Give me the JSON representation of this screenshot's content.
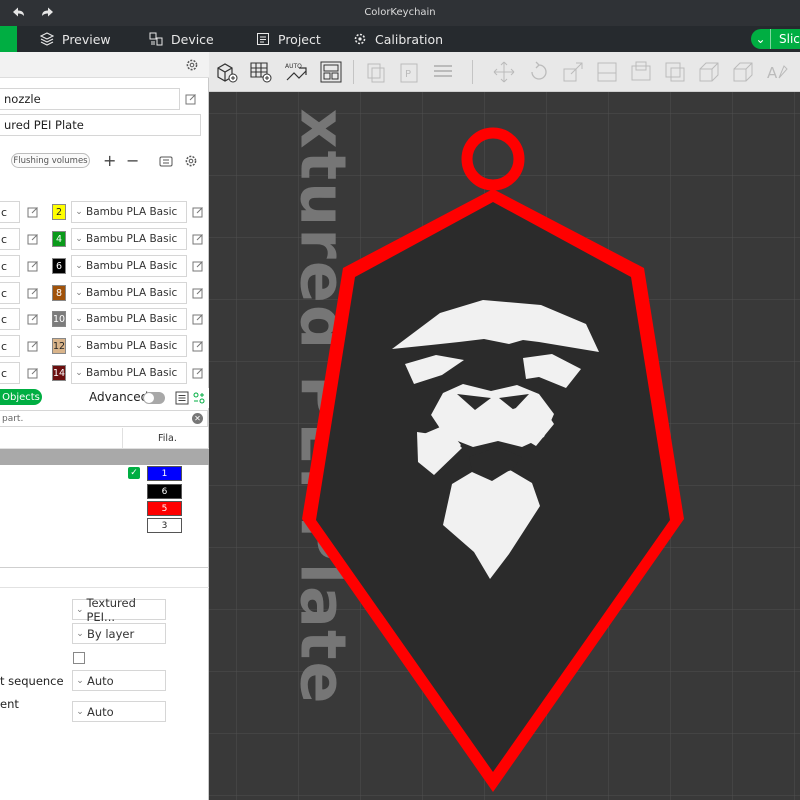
{
  "window": {
    "title": "ColorKeychain"
  },
  "tabs": {
    "preview": "Preview",
    "device": "Device",
    "project": "Project",
    "calibration": "Calibration",
    "slice": "Slic"
  },
  "printer": {
    "nozzle": "nozzle",
    "plate": "ured PEI Plate"
  },
  "filament": {
    "flushing_label": "Flushing volumes",
    "plus": "+",
    "minus": "−",
    "left_cells": [
      "c",
      "c",
      "c",
      "c",
      "c",
      "c",
      "c"
    ],
    "slots": [
      {
        "num": "2",
        "color": "#ffff00",
        "text_color": "#222222",
        "name": "Bambu PLA Basic"
      },
      {
        "num": "4",
        "color": "#0a9a1a",
        "text_color": "#ffffff",
        "name": "Bambu PLA Basic"
      },
      {
        "num": "6",
        "color": "#000000",
        "text_color": "#ffffff",
        "name": "Bambu PLA Basic"
      },
      {
        "num": "8",
        "color": "#a0520a",
        "text_color": "#ffffff",
        "name": "Bambu PLA Basic"
      },
      {
        "num": "10",
        "color": "#7c7c7c",
        "text_color": "#ffffff",
        "name": "Bambu PLA Basic"
      },
      {
        "num": "12",
        "color": "#d9b48a",
        "text_color": "#222222",
        "name": "Bambu PLA Basic"
      },
      {
        "num": "14",
        "color": "#6b0e0e",
        "text_color": "#ffffff",
        "name": "Bambu PLA Basic"
      }
    ]
  },
  "objects": {
    "tab_label": "Objects",
    "advanced_label": "Advanced",
    "search_placeholder": "part.",
    "fila_header": "Fila.",
    "fila_values": [
      {
        "num": "1",
        "color": "#0000ff",
        "text_color": "#ffffff"
      },
      {
        "num": "6",
        "color": "#000000",
        "text_color": "#ffffff"
      },
      {
        "num": "5",
        "color": "#ff0000",
        "text_color": "#ffffff"
      },
      {
        "num": "3",
        "color": "#ffffff",
        "text_color": "#222222"
      }
    ]
  },
  "plate_settings": {
    "plate_type": "Textured PEI...",
    "sequence": "By layer",
    "print_sequence_label": "t sequence",
    "print_sequence_value": "Auto",
    "placement_label": "ent",
    "placement_value": "Auto"
  },
  "viewport": {
    "plate_text": "xtured PEI Plate",
    "keychain_outline_color": "#ff0000",
    "keychain_fill_color": "#2a2a2a",
    "lion_color": "#f2f2f2"
  }
}
